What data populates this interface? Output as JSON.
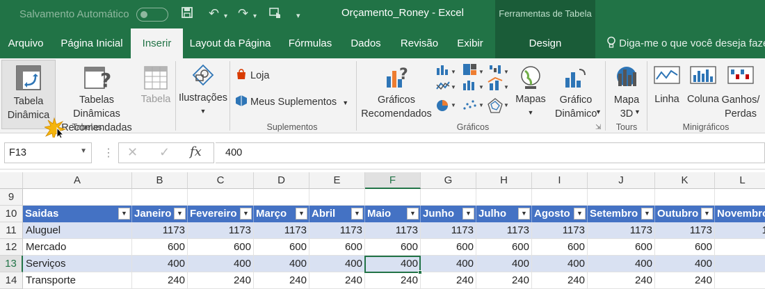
{
  "titlebar": {
    "autosave_label": "Salvamento Automático",
    "document_title": "Orçamento_Roney  -  Excel",
    "context_group": "Ferramentas de Tabela"
  },
  "tabs": [
    {
      "label": "Arquivo"
    },
    {
      "label": "Página Inicial"
    },
    {
      "label": "Inserir",
      "active": true
    },
    {
      "label": "Layout da Página"
    },
    {
      "label": "Fórmulas"
    },
    {
      "label": "Dados"
    },
    {
      "label": "Revisão"
    },
    {
      "label": "Exibir"
    },
    {
      "label": "Design"
    }
  ],
  "tellme": "Diga-me o que você deseja fazer",
  "ribbon": {
    "pivot_table": "Tabela Dinâmica",
    "recommended_pivot": "Tabelas Dinâmicas Recomendadas",
    "table": "Tabela",
    "group_tables": "Tabelas",
    "illustrations": "Ilustrações",
    "store": "Loja",
    "my_addins": "Meus Suplementos",
    "group_addins": "Suplementos",
    "recommended_charts": "Gráficos Recomendados",
    "maps": "Mapas",
    "pivot_chart": "Gráfico Dinâmico",
    "group_charts": "Gráficos",
    "map3d": "Mapa 3D",
    "group_tours": "Tours",
    "line": "Linha",
    "column": "Coluna",
    "winloss": "Ganhos/ Perdas",
    "group_sparklines": "Minigráficos"
  },
  "formula_bar": {
    "name_box": "F13",
    "fx": "fx",
    "value": "400"
  },
  "sheet": {
    "columns": [
      "A",
      "B",
      "C",
      "D",
      "E",
      "F",
      "G",
      "H",
      "I",
      "J",
      "K",
      "L"
    ],
    "selected_column": "F",
    "rows": [
      "9",
      "10",
      "11",
      "12",
      "13",
      "14"
    ],
    "selected_row": "13",
    "header_row": [
      "Saidas",
      "Janeiro",
      "Fevereiro",
      "Março",
      "Abril",
      "Maio",
      "Junho",
      "Julho",
      "Agosto",
      "Setembro",
      "Outubro",
      "Novembro"
    ],
    "data": [
      {
        "label": "Aluguel",
        "values": [
          "1173",
          "1173",
          "1173",
          "1173",
          "1173",
          "1173",
          "1173",
          "1173",
          "1173",
          "1173",
          "1"
        ]
      },
      {
        "label": "Mercado",
        "values": [
          "600",
          "600",
          "600",
          "600",
          "600",
          "600",
          "600",
          "600",
          "600",
          "600",
          ""
        ]
      },
      {
        "label": "Serviços",
        "values": [
          "400",
          "400",
          "400",
          "400",
          "400",
          "400",
          "400",
          "400",
          "400",
          "400",
          ""
        ]
      },
      {
        "label": "Transporte",
        "values": [
          "240",
          "240",
          "240",
          "240",
          "240",
          "240",
          "240",
          "240",
          "240",
          "240",
          ""
        ]
      }
    ],
    "header_color": "#4472c4",
    "band_color": "#d9e1f2"
  },
  "colors": {
    "excel_green": "#217346"
  }
}
